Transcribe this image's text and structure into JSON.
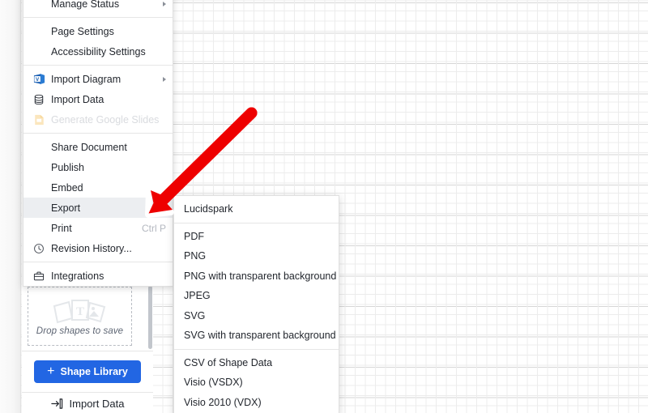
{
  "menu": {
    "name": "file-menu",
    "items": [
      {
        "label": "Manage Status",
        "icon": "none",
        "has_submenu": true,
        "disabled": false,
        "shortcut": ""
      },
      {
        "type": "separator"
      },
      {
        "label": "Page Settings",
        "icon": "none",
        "has_submenu": false,
        "disabled": false,
        "shortcut": ""
      },
      {
        "label": "Accessibility Settings",
        "icon": "none",
        "has_submenu": false,
        "disabled": false,
        "shortcut": ""
      },
      {
        "type": "separator"
      },
      {
        "label": "Import Diagram",
        "icon": "visio-icon",
        "has_submenu": true,
        "disabled": false,
        "shortcut": ""
      },
      {
        "label": "Import Data",
        "icon": "database-icon",
        "has_submenu": false,
        "disabled": false,
        "shortcut": ""
      },
      {
        "label": "Generate Google Slides",
        "icon": "google-slides-icon",
        "has_submenu": false,
        "disabled": true,
        "shortcut": ""
      },
      {
        "type": "separator"
      },
      {
        "label": "Share Document",
        "icon": "none",
        "has_submenu": false,
        "disabled": false,
        "shortcut": ""
      },
      {
        "label": "Publish",
        "icon": "none",
        "has_submenu": false,
        "disabled": false,
        "shortcut": ""
      },
      {
        "label": "Embed",
        "icon": "none",
        "has_submenu": false,
        "disabled": false,
        "shortcut": ""
      },
      {
        "label": "Export",
        "icon": "none",
        "has_submenu": true,
        "disabled": false,
        "shortcut": "",
        "highlighted": true
      },
      {
        "label": "Print",
        "icon": "none",
        "has_submenu": false,
        "disabled": false,
        "shortcut": "Ctrl P"
      },
      {
        "label": "Revision History...",
        "icon": "clock-icon",
        "has_submenu": false,
        "disabled": false,
        "shortcut": ""
      },
      {
        "type": "separator"
      },
      {
        "label": "Integrations",
        "icon": "briefcase-icon",
        "has_submenu": false,
        "disabled": false,
        "shortcut": ""
      }
    ]
  },
  "export_submenu": {
    "name": "export-submenu",
    "items": [
      {
        "label": "Lucidspark"
      },
      {
        "type": "separator"
      },
      {
        "label": "PDF"
      },
      {
        "label": "PNG"
      },
      {
        "label": "PNG with transparent background"
      },
      {
        "label": "JPEG"
      },
      {
        "label": "SVG"
      },
      {
        "label": "SVG with transparent background"
      },
      {
        "type": "separator"
      },
      {
        "label": "CSV of Shape Data"
      },
      {
        "label": "Visio (VSDX)"
      },
      {
        "label": "Visio 2010 (VDX)"
      }
    ]
  },
  "shape_panel": {
    "dropzone_label": "Drop shapes to save",
    "shape_library_button": "Shape Library",
    "shape_library_plus": "+",
    "import_data_label": "Import Data"
  },
  "colors": {
    "accent_blue": "#2266e3",
    "annotation_red": "#ee0000",
    "menu_highlight": "#eceef1",
    "disabled_text": "#d9dbdf",
    "shortcut_text": "#b4b8c0"
  }
}
